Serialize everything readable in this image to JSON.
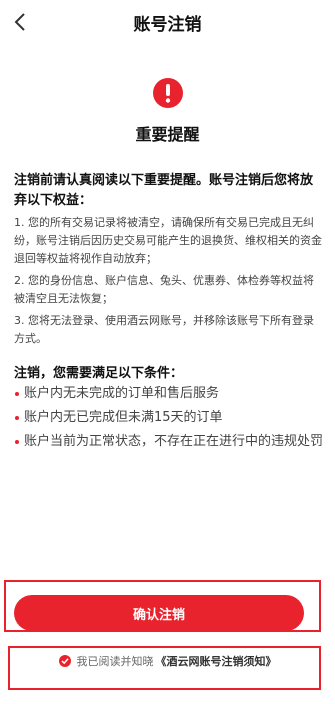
{
  "header": {
    "title": "账号注销",
    "back_icon": "chevron-left-icon"
  },
  "warning": {
    "icon": "exclamation-icon",
    "color": "#e8232d",
    "title": "重要提醒"
  },
  "intro": "注销前请认真阅读以下重要提醒。账号注销后您将放弃以下权益：",
  "notices": [
    "1. 您的所有交易记录将被清空，请确保所有交易已完成且无纠纷，账号注销后因历史交易可能产生的退换货、维权相关的资金退回等权益将视作自动放弃；",
    "2. 您的身份信息、账户信息、兔头、优惠券、体检券等权益将被清空且无法恢复；",
    "3. 您将无法登录、使用酒云网账号，并移除该账号下所有登录方式。"
  ],
  "conditions": {
    "title": "注销，您需要满足以下条件：",
    "items": [
      "账户内无未完成的订单和售后服务",
      "账户内无已完成但未满15天的订单",
      "账户当前为正常状态，不存在正在进行中的违规处罚"
    ]
  },
  "confirm_button": {
    "label": "确认注销"
  },
  "agreement": {
    "checked": true,
    "text": "我已阅读并知晓",
    "link": "《酒云网账号注销须知》"
  },
  "accent_color": "#e8232d"
}
